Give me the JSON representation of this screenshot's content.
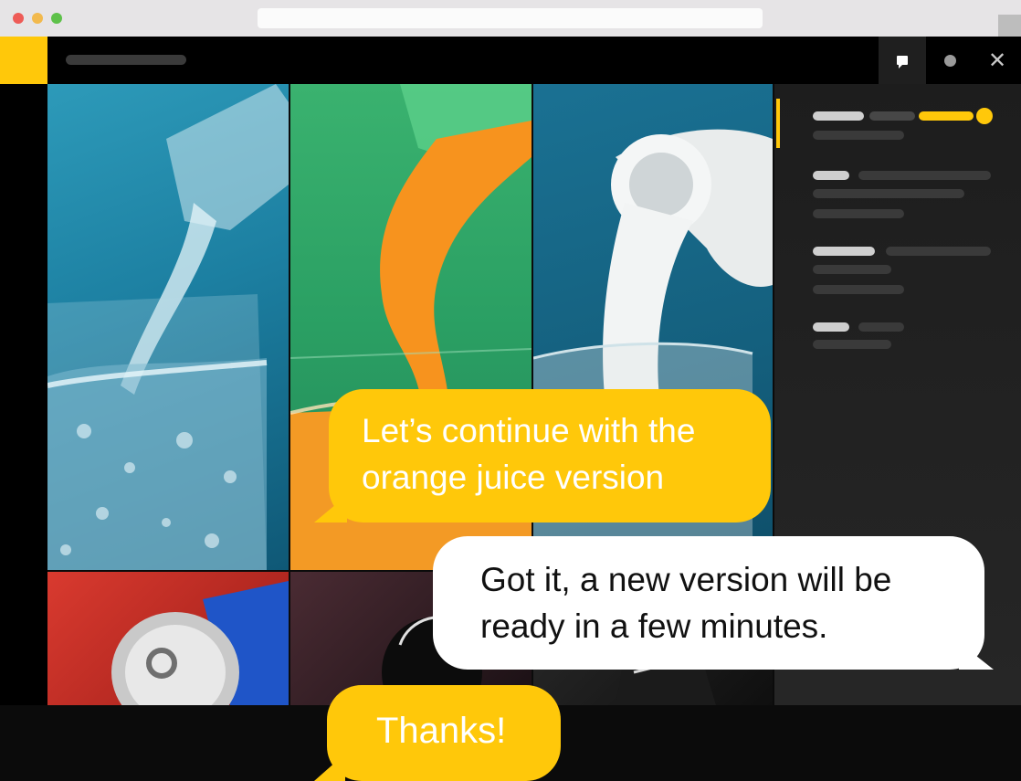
{
  "messages": [
    {
      "from": "client",
      "text_line1": "Let’s continue with the",
      "text_line2": "orange juice version"
    },
    {
      "from": "studio",
      "text_line1": "Got it, a new version will be",
      "text_line2": "ready in a few minutes."
    },
    {
      "from": "client",
      "text_line1": "Thanks!"
    }
  ],
  "gallery": {
    "tiles": [
      "water-pour",
      "orange-juice-pour",
      "milk-pour",
      "soda-can",
      "dark-bottle",
      "dark-glass"
    ]
  },
  "toolbar": {
    "icons": [
      "chat-icon",
      "record-icon",
      "close-icon"
    ],
    "close_glyph": "✕"
  },
  "colors": {
    "accent": "#ffc80a",
    "background": "#0b0b0b",
    "panel": "#222222",
    "bubble_client": "#ffc80a",
    "bubble_studio": "#ffffff"
  }
}
